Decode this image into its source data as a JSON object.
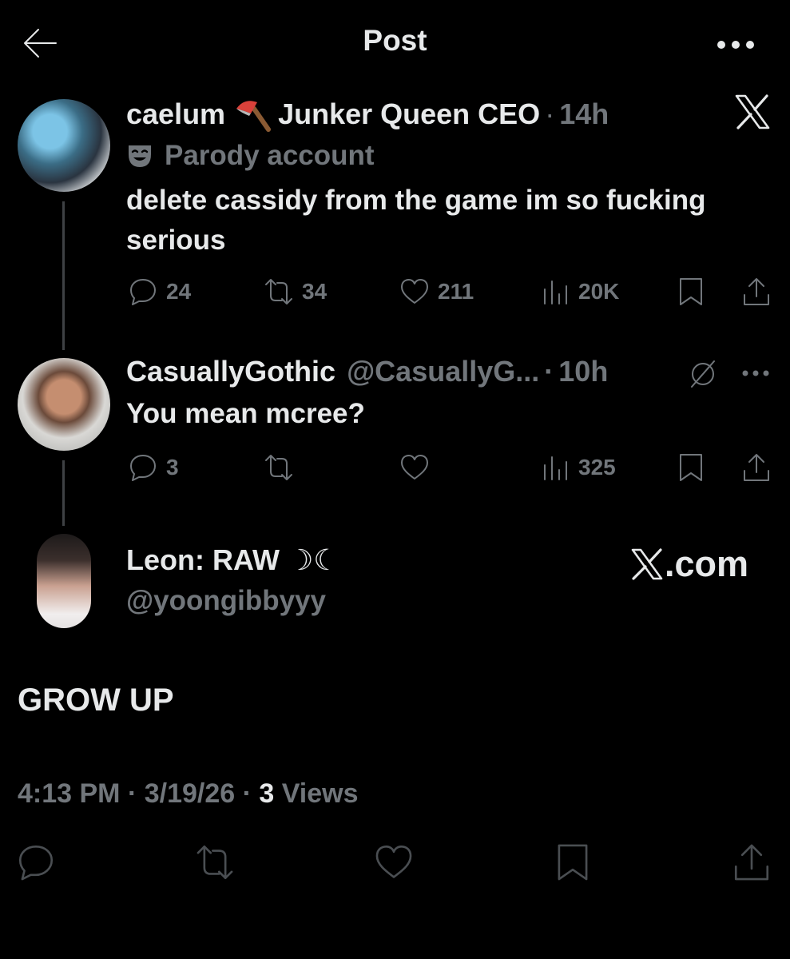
{
  "header": {
    "title": "Post",
    "back_icon": "arrow-left-icon",
    "more_icon": "more-horizontal-icon"
  },
  "tweet1": {
    "name_part1": "caelum",
    "emoji_icon": "axe-emoji-icon",
    "name_part2": "Junker Queen CEO",
    "separator": "·",
    "time": "14h",
    "parody_label": "Parody account",
    "body": "delete cassidy from the game im so fucking serious",
    "stats": {
      "replies": "24",
      "reposts": "34",
      "likes": "211",
      "views": "20K"
    }
  },
  "tweet2": {
    "name": "CasuallyGothic",
    "handle": "@CasuallyG...",
    "separator": "·",
    "time": "10h",
    "body": "You mean mcree?",
    "stats": {
      "replies": "3",
      "reposts": "",
      "likes": "",
      "views": "325"
    }
  },
  "tweet3": {
    "name": "Leon: RAW",
    "name_symbols": "☽☾",
    "handle": "@yoongibbyyy",
    "watermark": ".com",
    "text": "GROW UP",
    "timestamp": "4:13 PM · 3/19/26 · ",
    "views_count": "3",
    "views_label": " Views"
  },
  "colors": {
    "background": "#000000",
    "primary_text": "#e7e9ea",
    "secondary_text": "#71767b",
    "thread_line": "#3e4144"
  }
}
